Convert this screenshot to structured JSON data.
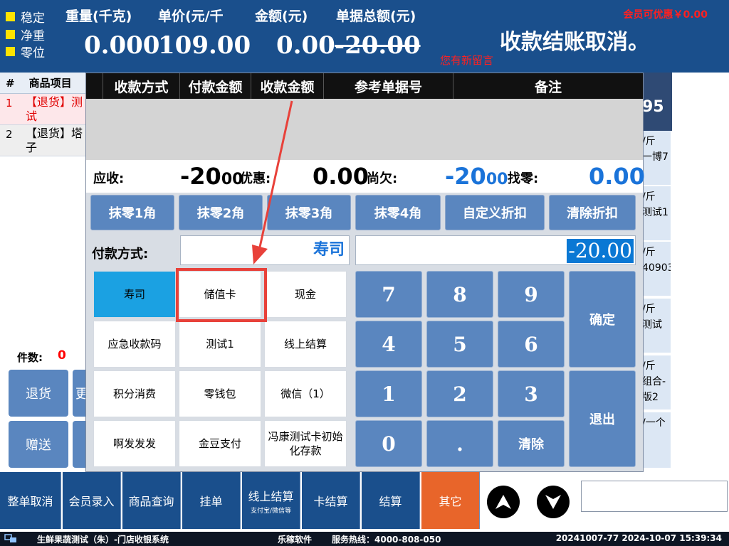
{
  "header": {
    "indicators": [
      "稳定",
      "净重",
      "零位"
    ],
    "weight_label": "重量(千克)",
    "weight_value": "0.000",
    "price_label": "单价(元/千",
    "price_value": "109.00",
    "amount_label": "金额(元)",
    "amount_value": "0.00",
    "total_label": "单据总额(元)",
    "total_value": "-20.00",
    "member_discount": "会员可优惠￥0.00",
    "status_message": "收款结账取消。",
    "message_notice": "您有新留言"
  },
  "product_list": {
    "columns": [
      "#",
      "商品项目"
    ],
    "rows": [
      {
        "num": "1",
        "name": "【退货】测试"
      },
      {
        "num": "2",
        "name": "【退货】塔子"
      }
    ],
    "count_label": "件数:",
    "count_value": "0",
    "side_buttons": [
      "退货",
      "赠送"
    ],
    "peek_buttons": [
      "更",
      ""
    ]
  },
  "right_column": {
    "top_value": "95",
    "cards": [
      "/斤\n一博7",
      "/斤\n测试1",
      "/斤\n40903",
      "/斤\n测试",
      "/斤\n组合-\n版2",
      "/一个"
    ]
  },
  "dialog": {
    "table_headers": [
      "收款方式",
      "付款金额",
      "收款金额",
      "参考单据号",
      "备注"
    ],
    "receivable_label": "应收:",
    "receivable_int": "-20",
    "receivable_dec": "00",
    "discount_label": "优惠:",
    "discount_value": "0.00",
    "owed_label": "尚欠:",
    "owed_int": "-20",
    "owed_dec": "00",
    "change_label": "找零:",
    "change_value": "0.00",
    "discount_buttons": [
      "抹零1角",
      "抹零2角",
      "抹零3角",
      "抹零4角",
      "自定义折扣",
      "清除折扣"
    ],
    "payment_method_label": "付款方式:",
    "payment_method_value": "寿司",
    "amount_value": "-20.00",
    "methods": [
      "寿司",
      "储值卡",
      "现金",
      "应急收款码",
      "测试1",
      "线上结算",
      "积分消费",
      "零钱包",
      "微信（1）",
      "啊发发发",
      "金豆支付",
      "冯康测试卡初始化存款"
    ],
    "keypad": [
      "7",
      "8",
      "9",
      "4",
      "5",
      "6",
      "1",
      "2",
      "3",
      "0",
      ".",
      "清除"
    ],
    "confirm_label": "确定",
    "exit_label": "退出"
  },
  "toolbar": {
    "buttons": [
      "整单取消",
      "会员录入",
      "商品查询",
      "挂单",
      "线上结算",
      "卡结算",
      "结算",
      "其它"
    ],
    "online_sub": "支付宝/微信等"
  },
  "statusbar": {
    "app_title": "生鲜果蔬测试（朱）-门店收银系统",
    "vendor": "乐稼软件",
    "hotline": "服务热线：4000-808-050",
    "session": "20241007-77 2024-10-07 15:39:34"
  },
  "colors": {
    "header_bg": "#1a4f8c",
    "button_blue": "#5a86bf",
    "active_method": "#1ba1e2",
    "accent_orange": "#e8652a",
    "highlight_red": "#e8413a",
    "value_blue": "#1a73d9"
  }
}
